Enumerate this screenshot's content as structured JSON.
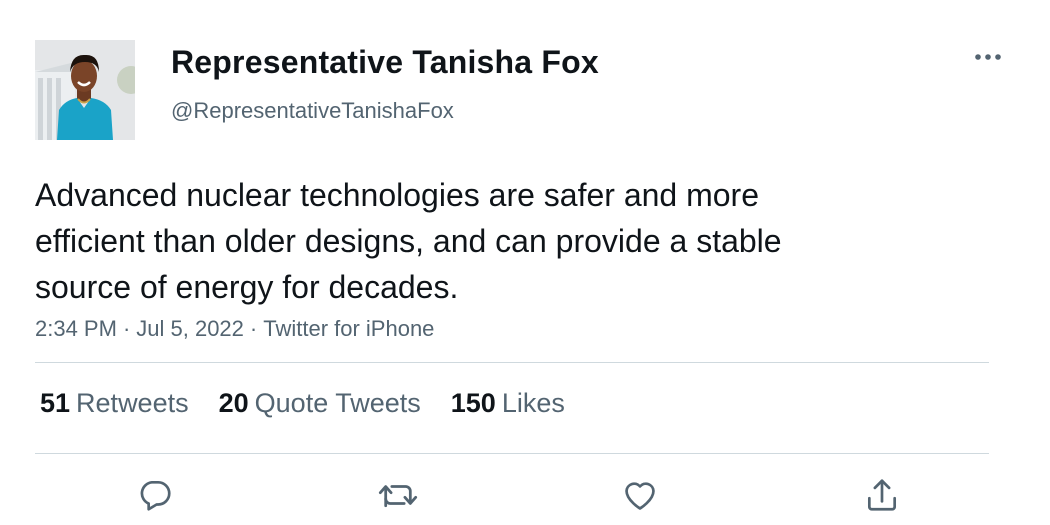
{
  "user": {
    "display_name": "Representative Tanisha Fox",
    "handle": "@RepresentativeTanishaFox",
    "avatar_icon": "profile-photo"
  },
  "tweet": {
    "text_lines": [
      "Advanced nuclear technologies are safer and more",
      "efficient than older designs, and can provide a stable",
      "source of energy for decades."
    ],
    "time": "2:34 PM",
    "date": "Jul 5, 2022",
    "source": "Twitter for iPhone",
    "separator": "·"
  },
  "stats": {
    "retweets": {
      "count": "51",
      "label": "Retweets"
    },
    "quotes": {
      "count": "20",
      "label": "Quote Tweets"
    },
    "likes": {
      "count": "150",
      "label": "Likes"
    }
  },
  "actions": [
    {
      "icon": "reply-icon"
    },
    {
      "icon": "retweet-icon"
    },
    {
      "icon": "like-icon"
    },
    {
      "icon": "share-icon"
    }
  ],
  "colors": {
    "text_primary": "#0f1419",
    "text_secondary": "#536471",
    "divider": "#cfd9de",
    "avatar_jacket": "#1aa3c8"
  }
}
